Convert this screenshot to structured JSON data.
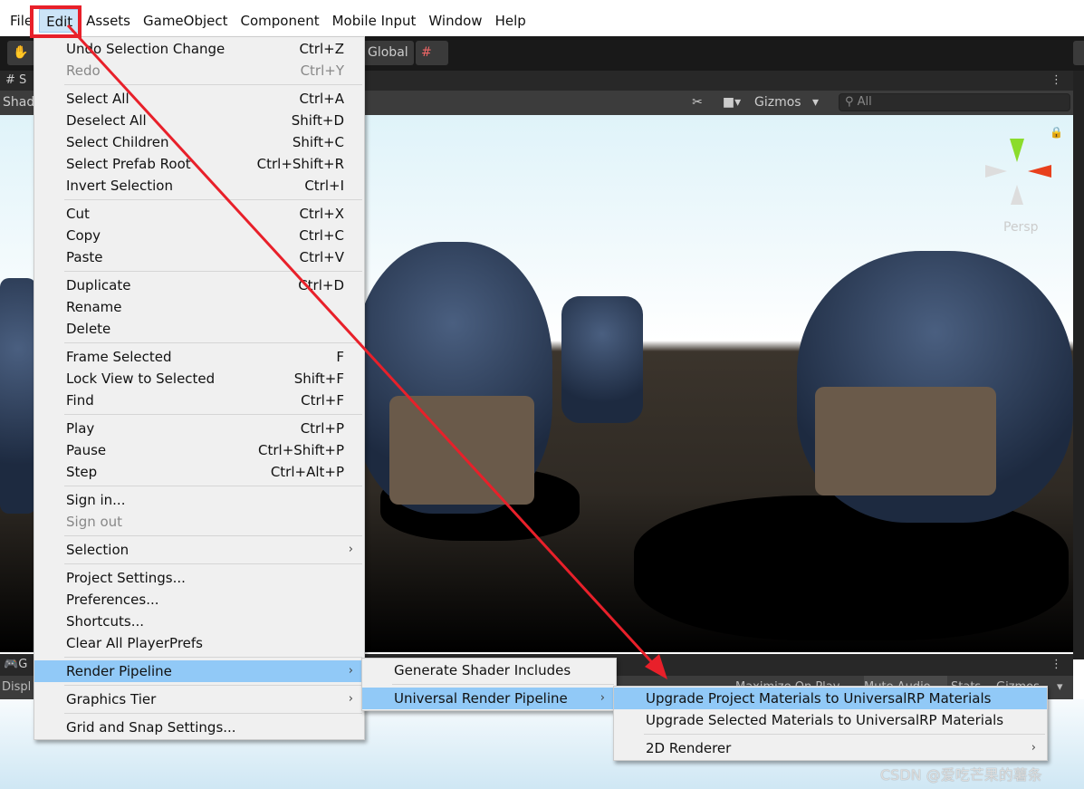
{
  "menubar": {
    "items": [
      "File",
      "Edit",
      "Assets",
      "GameObject",
      "Component",
      "Mobile Input",
      "Window",
      "Help"
    ],
    "active": "Edit"
  },
  "toolbar": {
    "global_label": "Global"
  },
  "scene": {
    "tab_label": "# S",
    "shading_label": "Shad",
    "gizmos_label": "Gizmos",
    "search_placeholder": "All",
    "persp_label": "Persp",
    "axis_y": "y"
  },
  "game": {
    "tab_label": "G",
    "display_label": "Displ",
    "buttons": [
      "Maximize On Play",
      "Mute Audio",
      "Stats",
      "Gizmos"
    ]
  },
  "edit_menu": [
    [
      {
        "label": "Undo Selection Change",
        "shortcut": "Ctrl+Z"
      },
      {
        "label": "Redo",
        "shortcut": "Ctrl+Y",
        "disabled": true
      }
    ],
    [
      {
        "label": "Select All",
        "shortcut": "Ctrl+A"
      },
      {
        "label": "Deselect All",
        "shortcut": "Shift+D"
      },
      {
        "label": "Select Children",
        "shortcut": "Shift+C"
      },
      {
        "label": "Select Prefab Root",
        "shortcut": "Ctrl+Shift+R"
      },
      {
        "label": "Invert Selection",
        "shortcut": "Ctrl+I"
      }
    ],
    [
      {
        "label": "Cut",
        "shortcut": "Ctrl+X"
      },
      {
        "label": "Copy",
        "shortcut": "Ctrl+C"
      },
      {
        "label": "Paste",
        "shortcut": "Ctrl+V"
      }
    ],
    [
      {
        "label": "Duplicate",
        "shortcut": "Ctrl+D"
      },
      {
        "label": "Rename",
        "shortcut": ""
      },
      {
        "label": "Delete",
        "shortcut": ""
      }
    ],
    [
      {
        "label": "Frame Selected",
        "shortcut": "F"
      },
      {
        "label": "Lock View to Selected",
        "shortcut": "Shift+F"
      },
      {
        "label": "Find",
        "shortcut": "Ctrl+F"
      }
    ],
    [
      {
        "label": "Play",
        "shortcut": "Ctrl+P"
      },
      {
        "label": "Pause",
        "shortcut": "Ctrl+Shift+P"
      },
      {
        "label": "Step",
        "shortcut": "Ctrl+Alt+P"
      }
    ],
    [
      {
        "label": "Sign in...",
        "shortcut": ""
      },
      {
        "label": "Sign out",
        "shortcut": "",
        "disabled": true
      }
    ],
    [
      {
        "label": "Selection",
        "shortcut": "",
        "submenu": true
      }
    ],
    [
      {
        "label": "Project Settings...",
        "shortcut": ""
      },
      {
        "label": "Preferences...",
        "shortcut": ""
      },
      {
        "label": "Shortcuts...",
        "shortcut": ""
      },
      {
        "label": "Clear All PlayerPrefs",
        "shortcut": ""
      }
    ],
    [
      {
        "label": "Render Pipeline",
        "shortcut": "",
        "submenu": true,
        "highlighted": true
      }
    ],
    [
      {
        "label": "Graphics Tier",
        "shortcut": "",
        "submenu": true
      }
    ],
    [
      {
        "label": "Grid and Snap Settings...",
        "shortcut": ""
      }
    ]
  ],
  "render_pipeline_menu": [
    [
      {
        "label": "Generate Shader Includes",
        "shortcut": ""
      }
    ],
    [
      {
        "label": "Universal Render Pipeline",
        "shortcut": "",
        "submenu": true,
        "highlighted": true
      }
    ]
  ],
  "urp_menu": [
    [
      {
        "label": "Upgrade Project Materials to UniversalRP Materials",
        "shortcut": "",
        "highlighted": true
      },
      {
        "label": "Upgrade Selected Materials to UniversalRP Materials",
        "shortcut": ""
      }
    ],
    [
      {
        "label": "2D Renderer",
        "shortcut": "",
        "submenu": true
      }
    ]
  ],
  "watermark": "CSDN @爱吃芒果的薯条",
  "colors": {
    "highlight": "#91c9f7",
    "annotation": "#e8202a"
  }
}
